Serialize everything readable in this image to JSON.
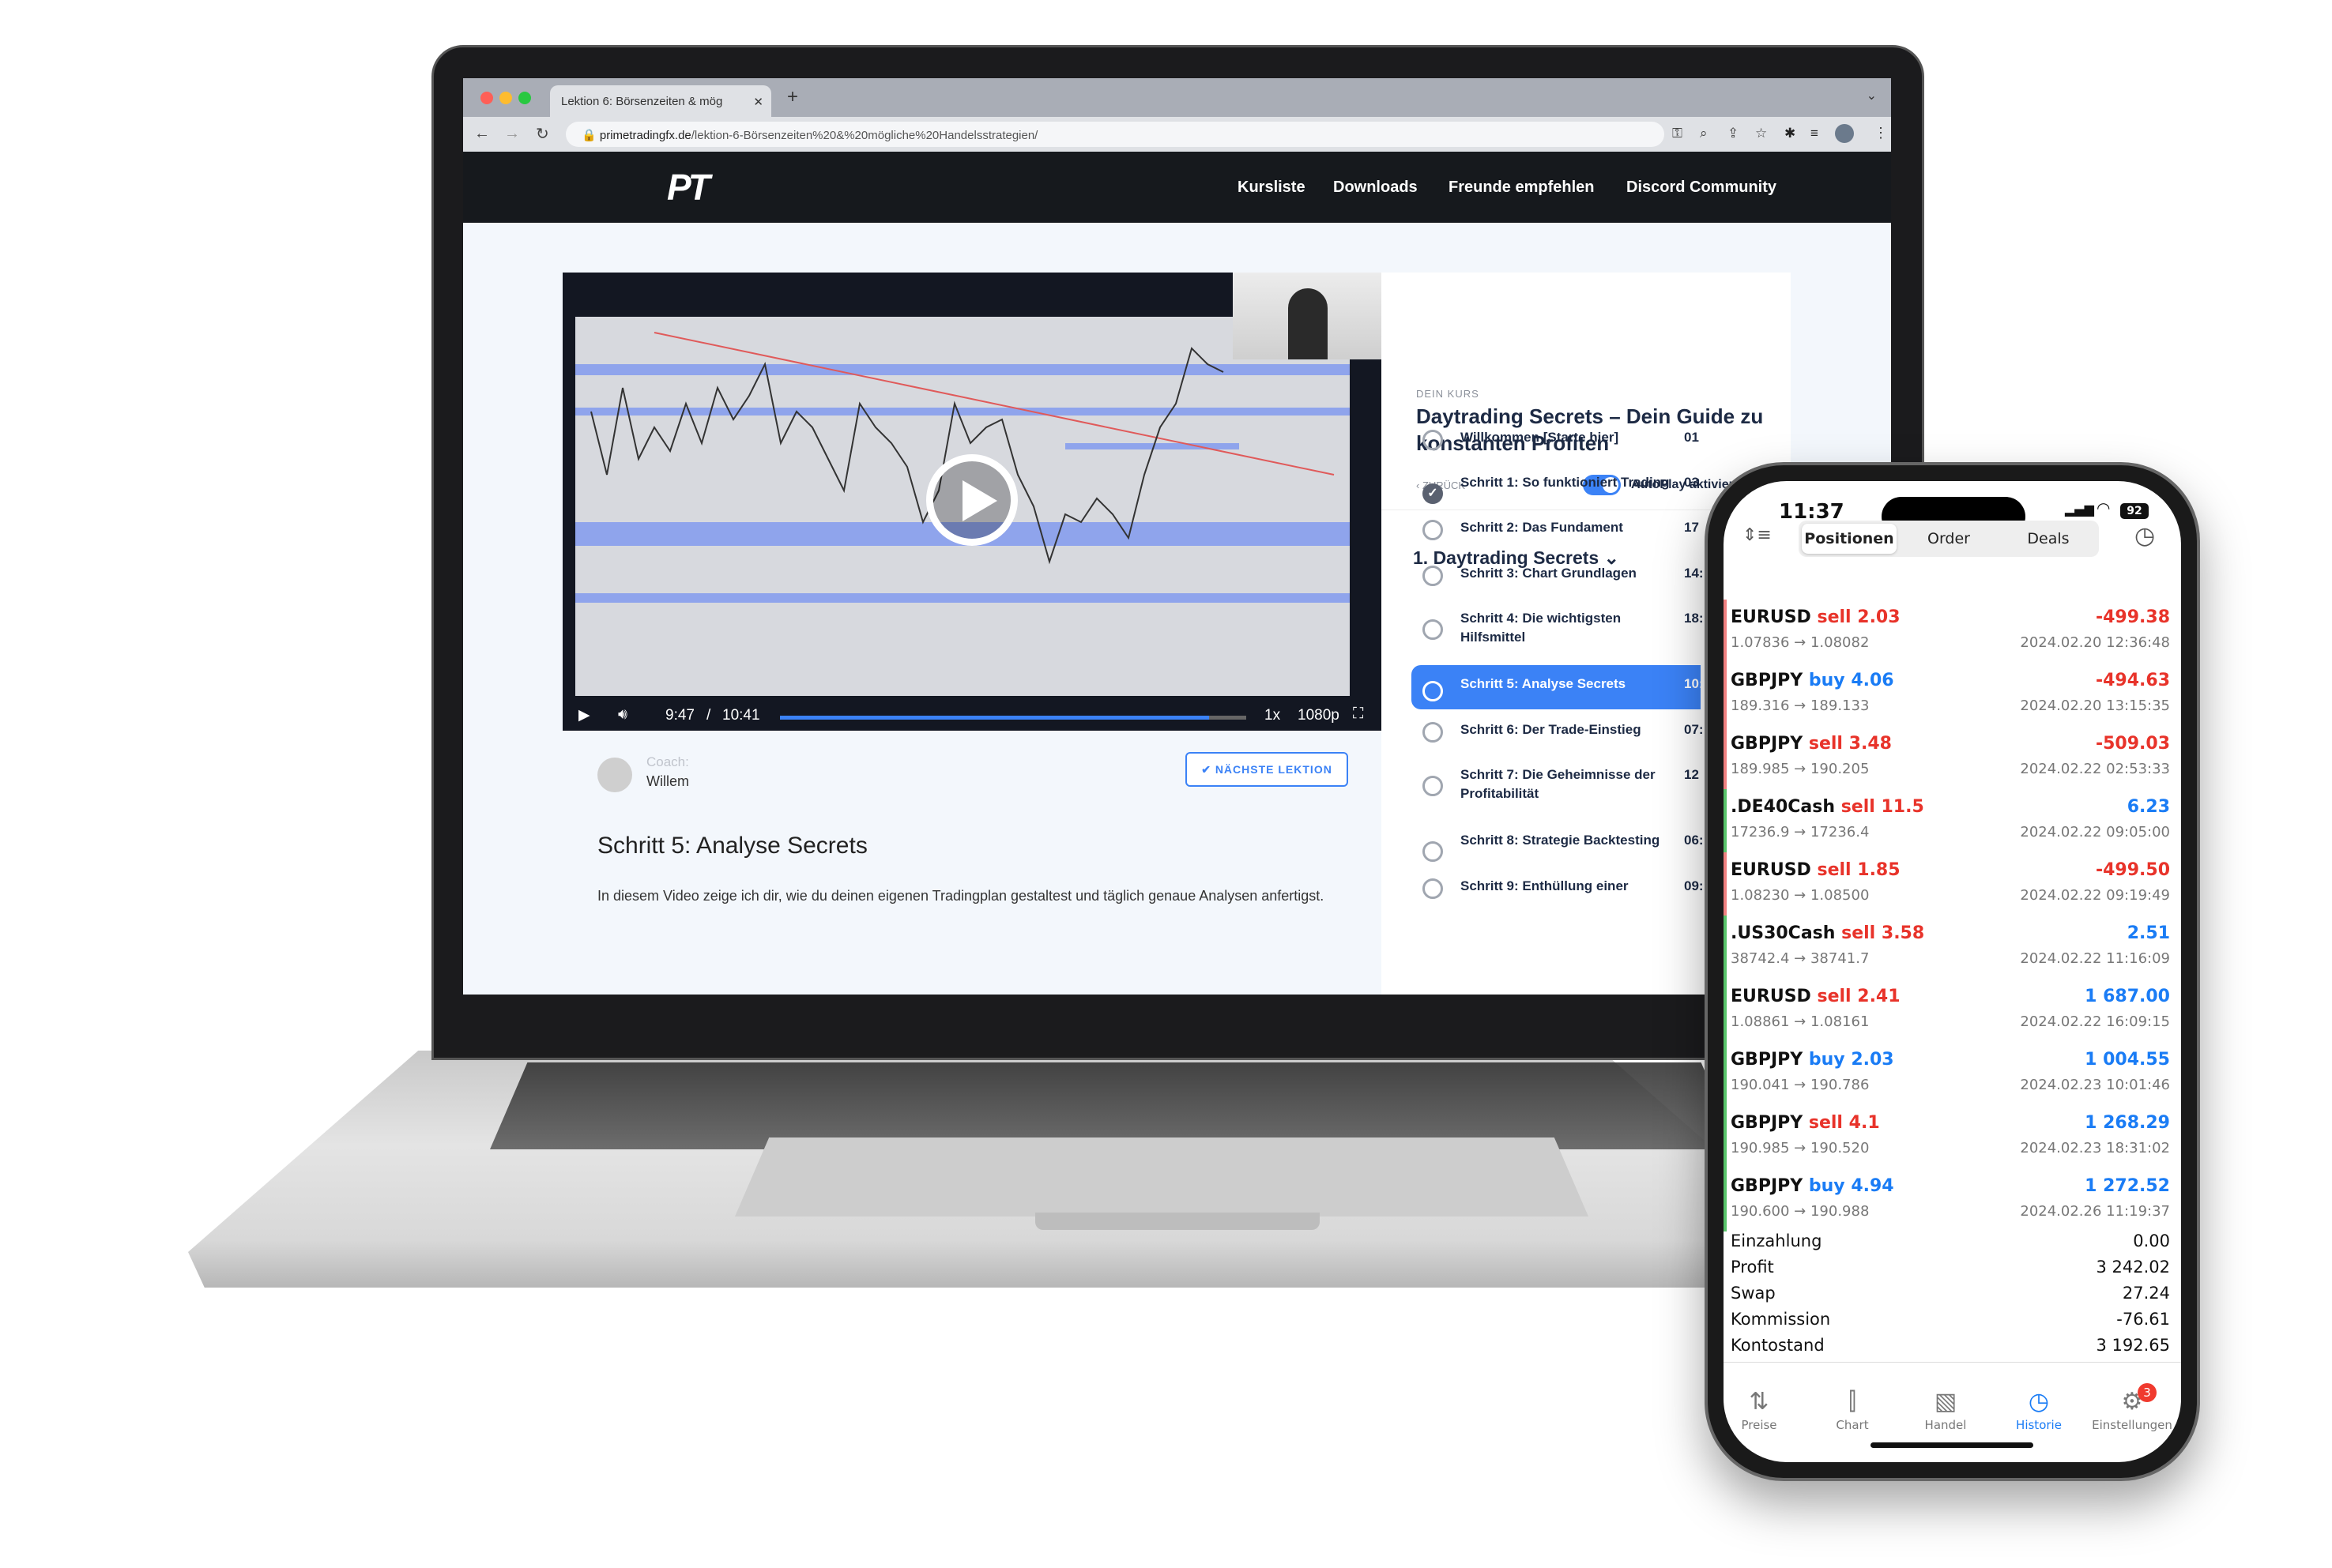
{
  "browser": {
    "tab_title": "Lektion 6: Börsenzeiten & mög",
    "url_domain": "primetradingfx.de",
    "url_path": "/lektion-6-Börsenzeiten%20&%20mögliche%20Handelsstrategien/"
  },
  "site": {
    "logo": "PT",
    "nav": [
      "Kursliste",
      "Downloads",
      "Freunde empfehlen",
      "Discord Community"
    ]
  },
  "video": {
    "current_time": "9:47",
    "separator": "/",
    "duration": "10:41",
    "progress": 0.92,
    "speed": "1x",
    "quality": "1080p"
  },
  "lesson": {
    "coach_label": "Coach:",
    "coach_name": "Willem",
    "next_button": "NÄCHSTE LEKTION",
    "title": "Schritt 5: Analyse Secrets",
    "description": "In diesem Video zeige ich dir, wie du deinen eigenen Tradingplan gestaltest und täglich genaue Analysen anfertigst."
  },
  "course": {
    "eyebrow": "DEIN KURS",
    "title": "Daytrading Secrets – Dein Guide zu konstanten Profiten",
    "back": "‹ ZURÜCK",
    "autoplay_label": "AutoPlay aktivieren",
    "autoplay_on": true,
    "section": "1. Daytrading Secrets ⌄",
    "items": [
      {
        "label": "Willkommen [Starte hier]",
        "duration": "01",
        "state": "open"
      },
      {
        "label": "Schritt 1: So funktioniert Trading",
        "duration": "03",
        "state": "done"
      },
      {
        "label": "Schritt 2: Das Fundament",
        "duration": "17",
        "state": "open"
      },
      {
        "label": "Schritt 3: Chart Grundlagen",
        "duration": "14:",
        "state": "open"
      },
      {
        "label": "Schritt 4: Die wichtigsten Hilfsmittel",
        "duration": "18:",
        "state": "open"
      },
      {
        "label": "Schritt 5: Analyse Secrets",
        "duration": "10:",
        "state": "active"
      },
      {
        "label": "Schritt 6: Der Trade-Einstieg",
        "duration": "07:",
        "state": "open"
      },
      {
        "label": "Schritt 7: Die Geheimnisse der Profitabilität",
        "duration": "12",
        "state": "open"
      },
      {
        "label": "Schritt 8: Strategie Backtesting",
        "duration": "06:",
        "state": "open"
      },
      {
        "label": "Schritt 9: Enthüllung einer",
        "duration": "09:",
        "state": "open"
      }
    ]
  },
  "phone": {
    "time": "11:37",
    "battery": "92",
    "tabs": [
      "Positionen",
      "Order",
      "Deals"
    ],
    "active_tab": "Positionen",
    "colors": {
      "sell": "#e8332a",
      "buy": "#1a7cf5",
      "loss": "#e8332a",
      "profit": "#1a7cf5"
    },
    "trades": [
      {
        "symbol": "EURUSD",
        "side": "sell",
        "volume": "2.03",
        "prices": "1.07836 → 1.08082",
        "pl": "-499.38",
        "date": "2024.02.20 12:36:48"
      },
      {
        "symbol": "GBPJPY",
        "side": "buy",
        "volume": "4.06",
        "prices": "189.316 → 189.133",
        "pl": "-494.63",
        "date": "2024.02.20 13:15:35"
      },
      {
        "symbol": "GBPJPY",
        "side": "sell",
        "volume": "3.48",
        "prices": "189.985 → 190.205",
        "pl": "-509.03",
        "date": "2024.02.22 02:53:33"
      },
      {
        "symbol": ".DE40Cash",
        "side": "sell",
        "volume": "11.5",
        "prices": "17236.9 → 17236.4",
        "pl": "6.23",
        "date": "2024.02.22 09:05:00"
      },
      {
        "symbol": "EURUSD",
        "side": "sell",
        "volume": "1.85",
        "prices": "1.08230 → 1.08500",
        "pl": "-499.50",
        "date": "2024.02.22 09:19:49"
      },
      {
        "symbol": ".US30Cash",
        "side": "sell",
        "volume": "3.58",
        "prices": "38742.4 → 38741.7",
        "pl": "2.51",
        "date": "2024.02.22 11:16:09"
      },
      {
        "symbol": "EURUSD",
        "side": "sell",
        "volume": "2.41",
        "prices": "1.08861 → 1.08161",
        "pl": "1 687.00",
        "date": "2024.02.22 16:09:15"
      },
      {
        "symbol": "GBPJPY",
        "side": "buy",
        "volume": "2.03",
        "prices": "190.041 → 190.786",
        "pl": "1 004.55",
        "date": "2024.02.23 10:01:46"
      },
      {
        "symbol": "GBPJPY",
        "side": "sell",
        "volume": "4.1",
        "prices": "190.985 → 190.520",
        "pl": "1 268.29",
        "date": "2024.02.23 18:31:02"
      },
      {
        "symbol": "GBPJPY",
        "side": "buy",
        "volume": "4.94",
        "prices": "190.600 → 190.988",
        "pl": "1 272.52",
        "date": "2024.02.26 11:19:37"
      }
    ],
    "summary": [
      {
        "label": "Einzahlung",
        "value": "0.00"
      },
      {
        "label": "Profit",
        "value": "3 242.02"
      },
      {
        "label": "Swap",
        "value": "27.24"
      },
      {
        "label": "Kommission",
        "value": "-76.61"
      },
      {
        "label": "Kontostand",
        "value": "3 192.65"
      }
    ],
    "bottom_nav": [
      {
        "label": "Preise",
        "icon": "arrows-updown-icon",
        "glyph": "⇅"
      },
      {
        "label": "Chart",
        "icon": "candlestick-icon",
        "glyph": "⫿"
      },
      {
        "label": "Handel",
        "icon": "trade-chart-icon",
        "glyph": "▧"
      },
      {
        "label": "Historie",
        "icon": "history-icon",
        "glyph": "◷"
      },
      {
        "label": "Einstellungen",
        "icon": "gear-icon",
        "glyph": "⚙",
        "badge": "3"
      }
    ],
    "active_nav": "Historie"
  }
}
